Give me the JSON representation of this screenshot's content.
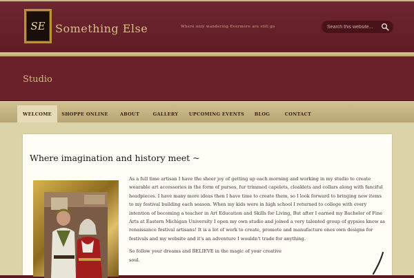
{
  "header": {
    "logo_text": "SE",
    "site_title": "Something Else",
    "tagline": "Where only wandering Ever­more are still go",
    "search_placeholder": "Search this website..."
  },
  "studio": {
    "title": "Studio"
  },
  "nav": {
    "items": [
      {
        "label": "WELCOME",
        "active": true
      },
      {
        "label": "SHOPPE ONLINE",
        "active": false
      },
      {
        "label": "ABOUT",
        "active": false
      },
      {
        "label": "GALLERY",
        "active": false
      },
      {
        "label": "UPCOMING EVENTS",
        "active": false
      },
      {
        "label": "BLOG",
        "active": false
      },
      {
        "label": "CONTACT",
        "active": false
      }
    ]
  },
  "main": {
    "heading": "Where imagination and history meet ~",
    "paragraph1": "As a full time artisan I have the sheer joy of getting up each morning and working in my studio to create wearable art accessories in the form of purses, fur trimmed capelets, cloaklets and collars along with fanciful headpieces. I have many more ideas then I have time to create them, so I look forward to bringing new items to my festival building each season. When my kids were in high school I returned to college with every intention of becoming a teacher in Art Education and Skills for Living, But after I earned my Bachelor of Fine Arts at Eastern Michigan University I open my own studio and joined a very talented group of gypsies know as renaissance festival artisans! It is a lot of work to create, promote and manufacture ones own designs for festivals and my website and it's an adventure I wouldn't trade for anything.",
    "paragraph2": "So follow your dreams and BELIEVE in the magic of your creative soul."
  },
  "colors": {
    "header_bg": "#611c26",
    "nav_bg": "#c4b27f",
    "title_gold": "#d8c08a",
    "content_bg": "#fffdf6"
  },
  "icons": {
    "search": "search-icon"
  }
}
